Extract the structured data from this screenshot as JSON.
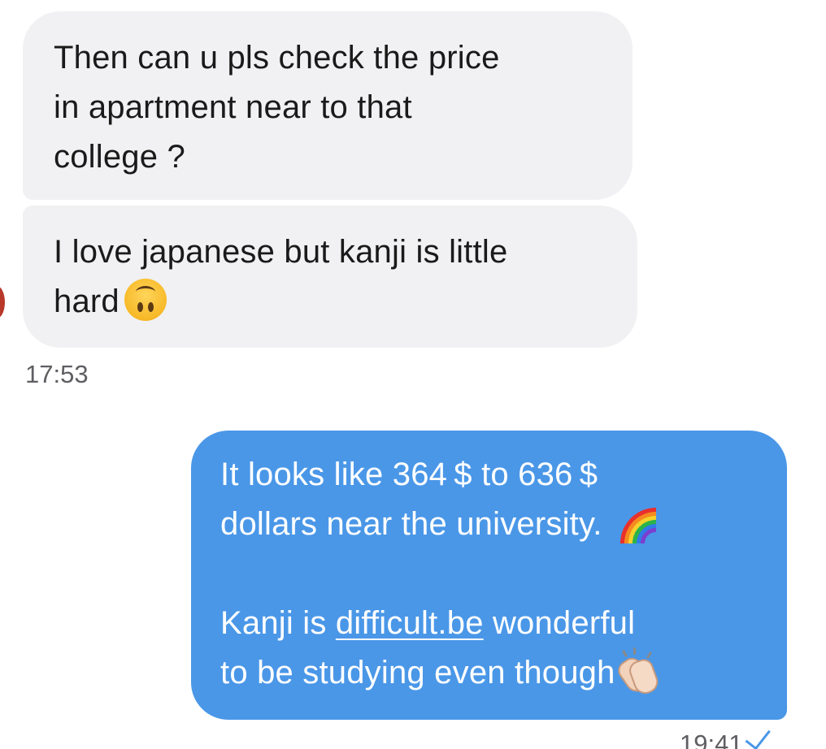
{
  "incoming": {
    "message1_lines": [
      "Then can u pls check the price",
      "in apartment near to that",
      "college ?"
    ],
    "message2_lines": [
      "I love japanese but kanji is little",
      "hard"
    ],
    "message2_emoji": "upside-down-face",
    "timestamp": "17:53"
  },
  "outgoing": {
    "p1_line1": "It looks like 364 $  to 636 $",
    "p1_line2": "dollars near the university.",
    "p1_emoji": "rainbow",
    "p2_line1_pre": "Kanji is ",
    "p2_link": "difficult.be",
    "p2_line1_post": " wonderful",
    "p2_line2": "to be studying even though",
    "p2_emoji": "clapping-hands",
    "timestamp": "19:41",
    "status": "sent-checkmark"
  },
  "colors": {
    "incoming_bubble": "#f1f1f3",
    "outgoing_bubble": "#4a97e8",
    "timestamp_text": "#5e5e63"
  }
}
